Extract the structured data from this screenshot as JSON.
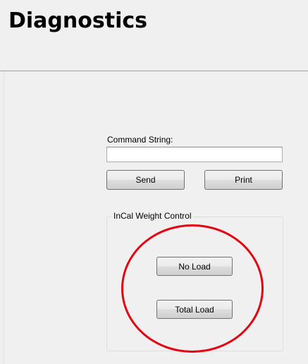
{
  "header": {
    "title": "Diagnostics"
  },
  "command": {
    "label": "Command String:",
    "value": "",
    "placeholder": ""
  },
  "buttons": {
    "send_label": "Send",
    "print_label": "Print"
  },
  "incal_group": {
    "title": "InCal Weight Control",
    "no_load_label": "No Load",
    "total_load_label": "Total Load"
  },
  "colors": {
    "background": "#f0f0f0",
    "annotation": "#e30613"
  }
}
